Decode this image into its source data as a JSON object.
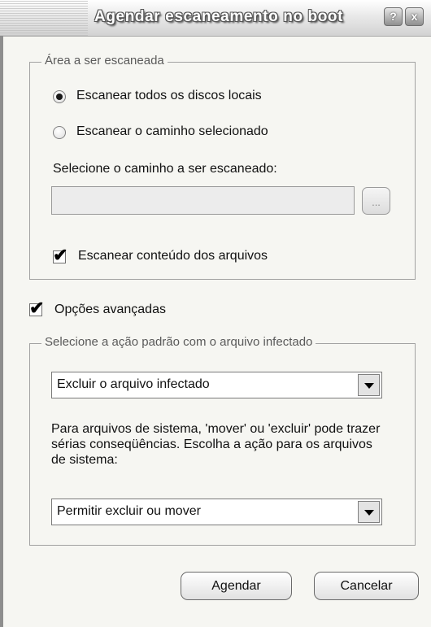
{
  "window": {
    "title": "Agendar escaneamento no boot",
    "help_glyph": "?",
    "close_glyph": "x"
  },
  "scan_area": {
    "legend": "Área a ser escaneada",
    "option_all": {
      "label": "Escanear todos os discos locais",
      "selected": true
    },
    "option_path": {
      "label": "Escanear o caminho selecionado",
      "selected": false
    },
    "path_label": "Selecione o caminho a ser escaneado:",
    "path_value": "",
    "browse_label": "...",
    "scan_contents": {
      "label": "Escanear conteúdo dos arquivos",
      "checked": true
    }
  },
  "advanced": {
    "label": "Opções avançadas",
    "checked": true
  },
  "infected_action": {
    "legend": "Selecione a ação padrão com o arquivo infectado",
    "default_action": "Excluir o arquivo infectado",
    "description": "Para arquivos de sistema, 'mover' ou 'excluir' pode trazer sérias conseqüências. Escolha a ação para os arquivos de sistema:",
    "system_action": "Permitir excluir ou mover"
  },
  "buttons": {
    "schedule": "Agendar",
    "cancel": "Cancelar"
  },
  "check_glyph": "✔",
  "colors": {
    "group_border": "#a2a2a2",
    "dialog_bg": "#f6f6f2",
    "title_text": "#ffffff"
  }
}
